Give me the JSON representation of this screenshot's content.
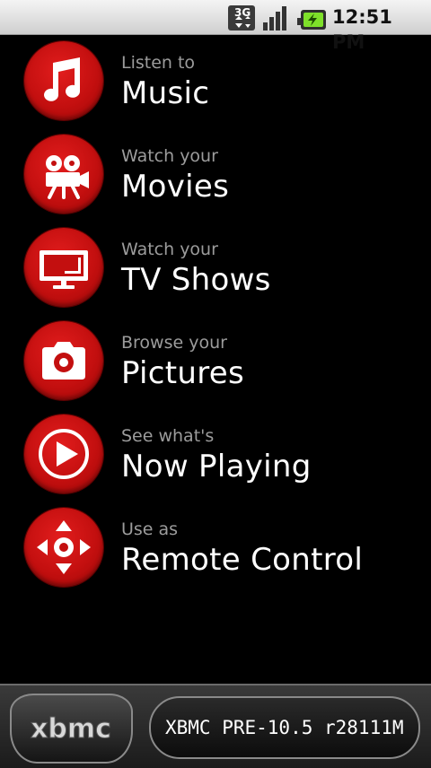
{
  "status_bar": {
    "network_label": "3G",
    "time": "12:51 PM",
    "icons": [
      "3g-data-icon",
      "signal-strength-icon",
      "battery-charging-icon"
    ]
  },
  "menu": {
    "items": [
      {
        "subtitle": "Listen to",
        "title": "Music",
        "icon": "music-note-icon"
      },
      {
        "subtitle": "Watch your",
        "title": "Movies",
        "icon": "movie-camera-icon"
      },
      {
        "subtitle": "Watch your",
        "title": "TV Shows",
        "icon": "tv-icon"
      },
      {
        "subtitle": "Browse your",
        "title": "Pictures",
        "icon": "camera-icon"
      },
      {
        "subtitle": "See what's",
        "title": "Now Playing",
        "icon": "play-icon"
      },
      {
        "subtitle": "Use as",
        "title": "Remote Control",
        "icon": "dpad-icon"
      }
    ]
  },
  "footer": {
    "logo_text": "xbmc",
    "version": "XBMC PRE-10.5 r28111M"
  },
  "colors": {
    "background": "#000000",
    "accent_red": "#c30f0f",
    "subtitle_gray": "#9c9c9c",
    "title_white": "#ffffff"
  }
}
